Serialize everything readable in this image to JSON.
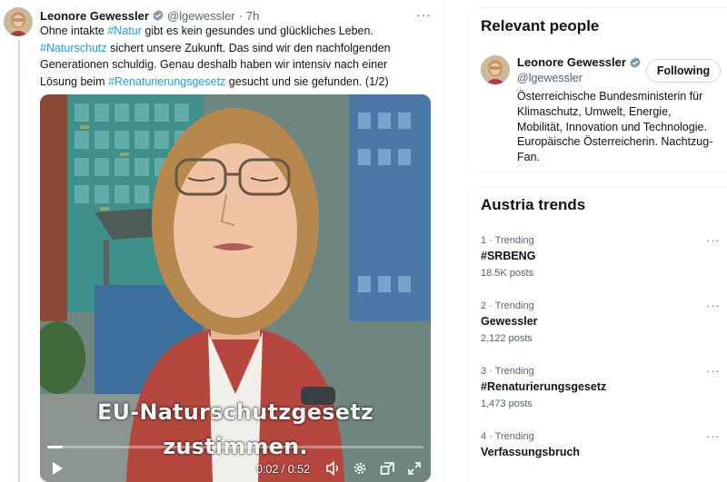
{
  "tweet": {
    "author_name": "Leonore Gewessler",
    "handle": "@lgewessler",
    "separator": "·",
    "time": "7h",
    "more": "···",
    "lines": [
      [
        {
          "t": "Ohne intakte ",
          "tag": false
        },
        {
          "t": "#Natur",
          "tag": true
        },
        {
          "t": " gibt es kein gesundes und glückliches Leben.",
          "tag": false
        }
      ],
      [
        {
          "t": "#Naturschutz",
          "tag": true
        },
        {
          "t": " sichert unsere Zukunft. Das sind wir den nachfolgenden",
          "tag": false
        }
      ],
      [
        {
          "t": "Generationen schuldig. Genau deshalb haben wir intensiv nach einer",
          "tag": false
        }
      ],
      [
        {
          "t": "Lösung beim ",
          "tag": false
        },
        {
          "t": "#Renaturierungsgesetz",
          "tag": true
        },
        {
          "t": " gesucht und sie gefunden. (1/2)",
          "tag": false
        }
      ]
    ],
    "video": {
      "caption_line1": "EU-Naturschutzgesetz",
      "caption_line2": "zustimmen.",
      "time_readout": "0:02 / 0:52",
      "progress": 0.04
    }
  },
  "relevant_people": {
    "title": "Relevant people",
    "name": "Leonore Gewessler",
    "handle": "@lgewessler",
    "follow_label": "Following",
    "bio": [
      "Österreichische Bundesministerin für",
      "Klimaschutz, Umwelt, Energie,",
      "Mobilität, Innovation und Technologie.",
      "Europäische Österreicherin. Nachtzug-",
      "Fan."
    ]
  },
  "trends": {
    "title": "Austria trends",
    "items": [
      {
        "meta": "1 · Trending",
        "name": "#SRBENG",
        "posts": "18.5K posts"
      },
      {
        "meta": "2 · Trending",
        "name": "Gewessler",
        "posts": "2,122 posts"
      },
      {
        "meta": "3 · Trending",
        "name": "#Renaturierungsgesetz",
        "posts": "1,473 posts"
      },
      {
        "meta": "4 · Trending",
        "name": "Verfassungsbruch",
        "posts": ""
      }
    ]
  },
  "colors": {
    "link": "#1d9bf0",
    "text": "#0f1419",
    "muted": "#536471",
    "verified": "#829aab"
  },
  "icons": [
    "verified-badge-icon",
    "more-icon",
    "play-icon",
    "volume-icon",
    "settings-icon",
    "pip-icon",
    "fullscreen-icon"
  ]
}
